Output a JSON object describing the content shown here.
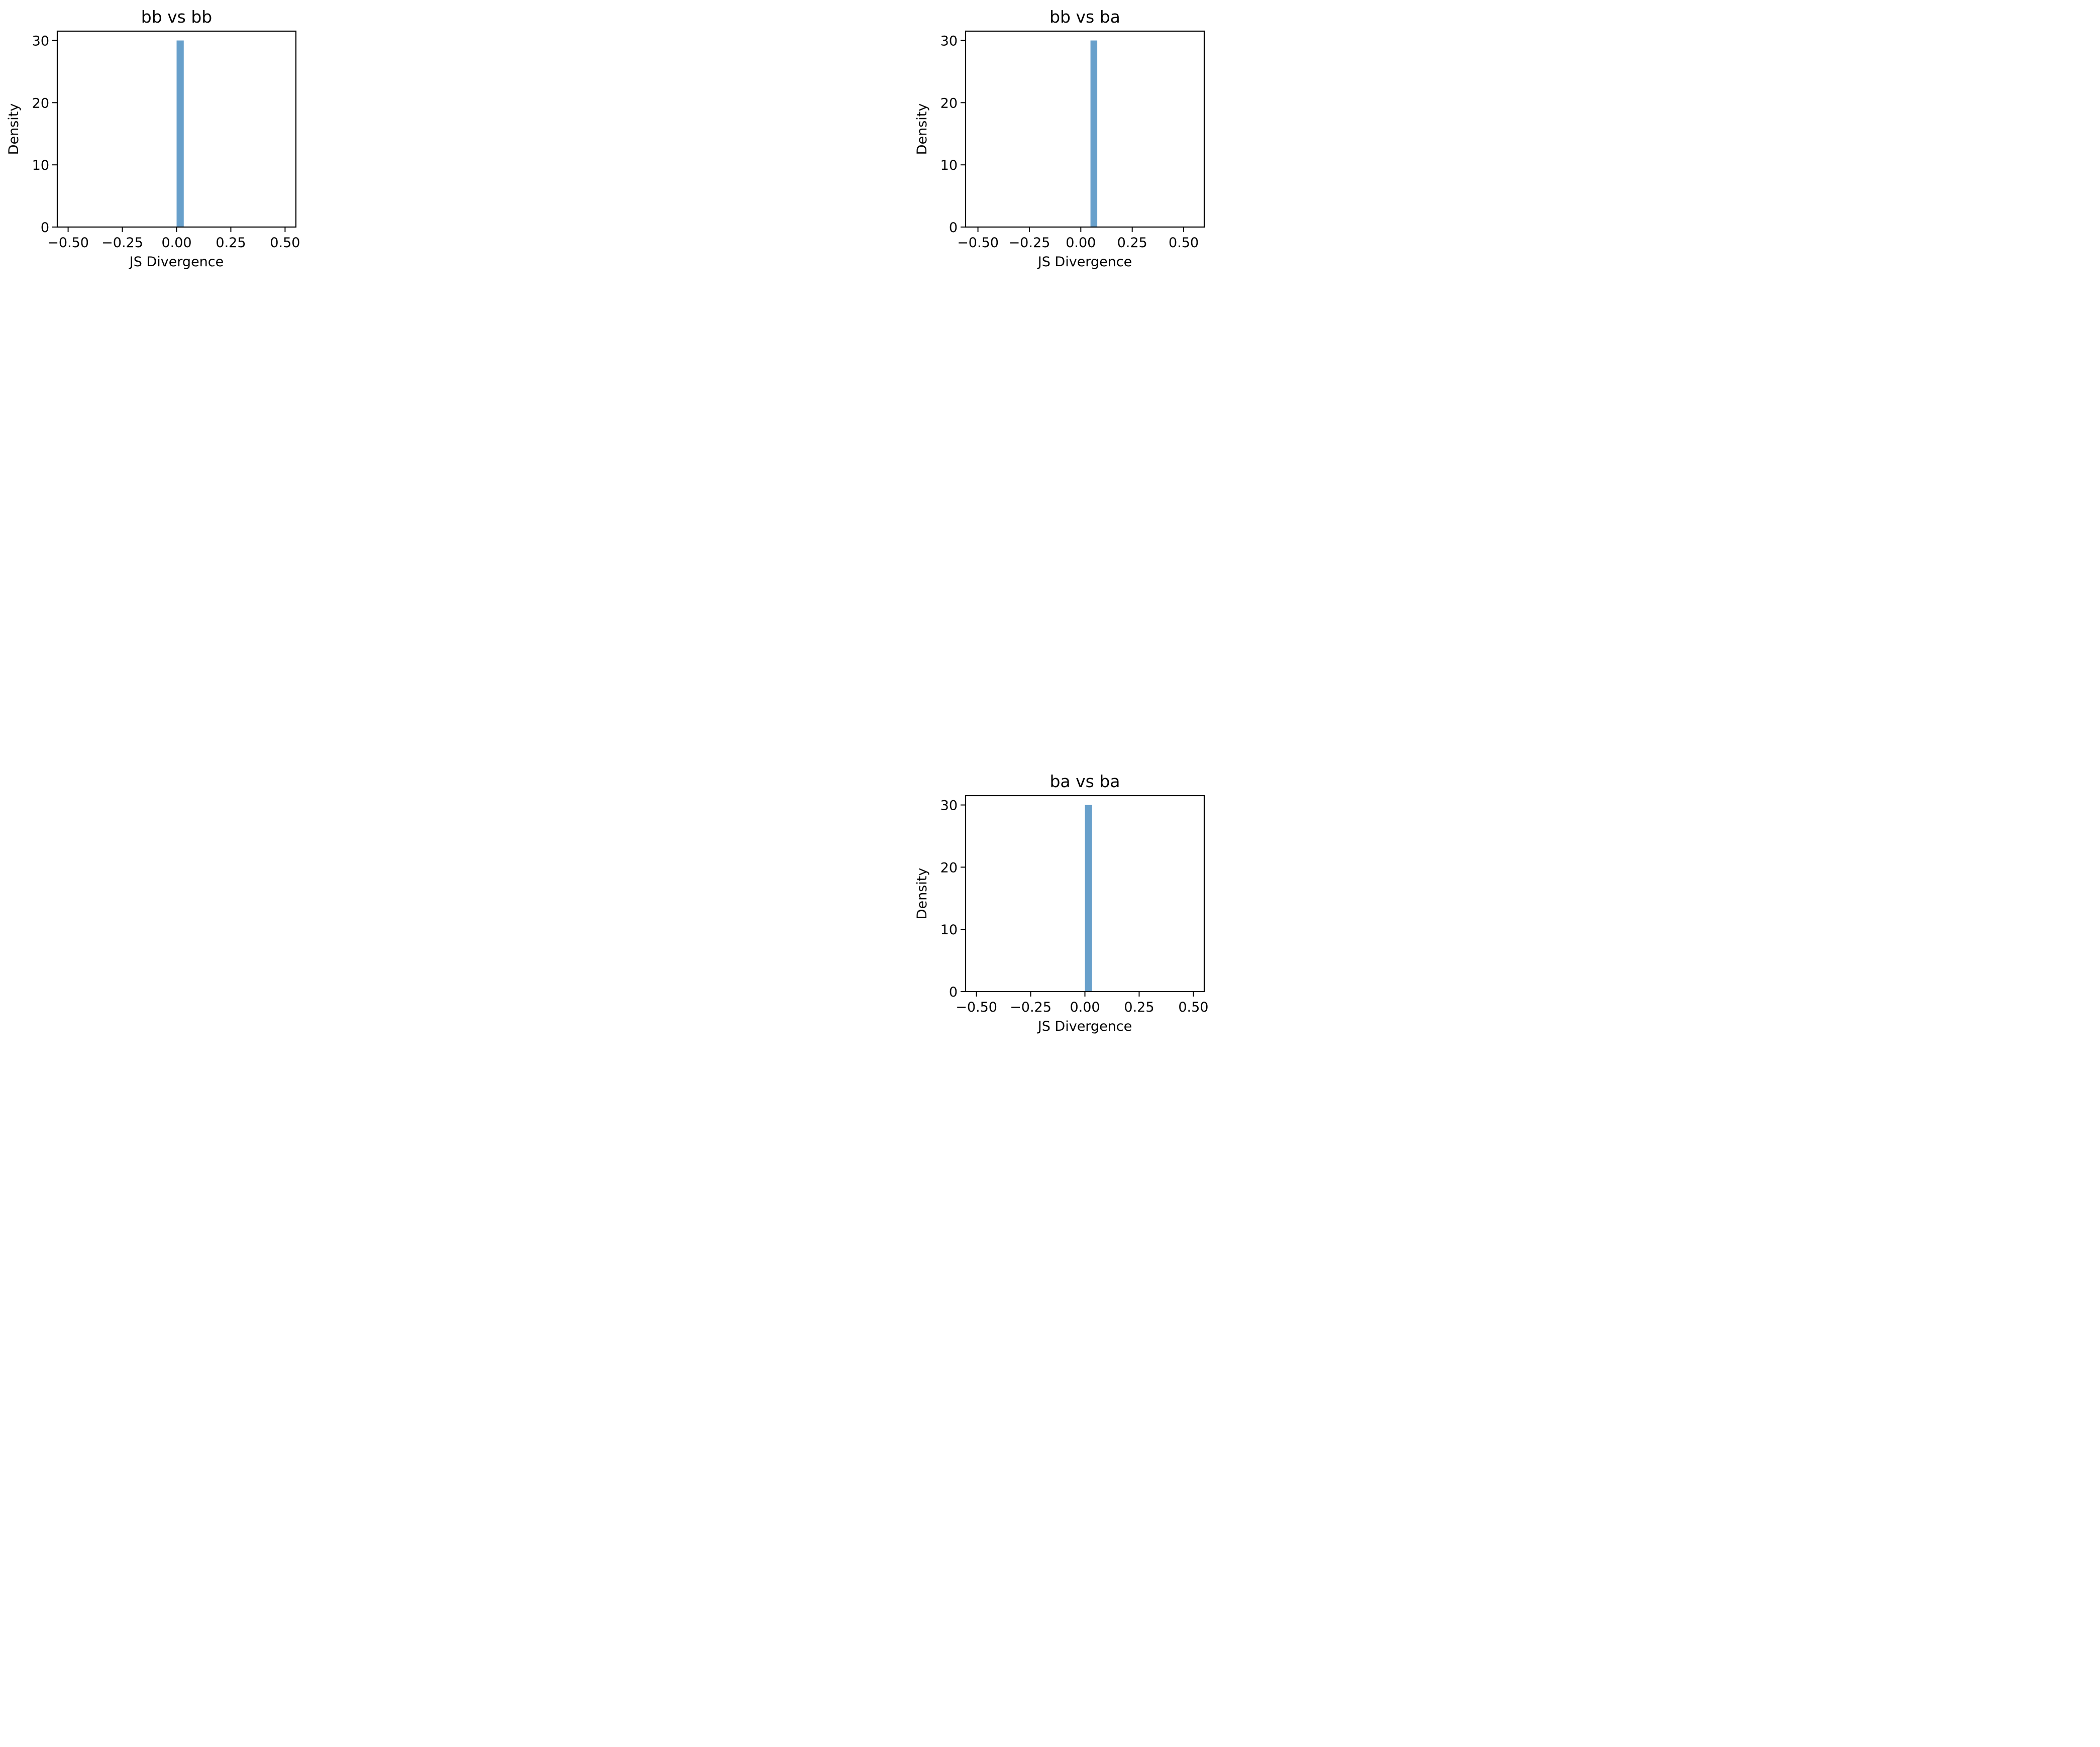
{
  "colors": {
    "bar": "#2878b5",
    "axis": "#000000",
    "background": "#ffffff"
  },
  "chart_data": [
    {
      "type": "bar",
      "title": "bb vs bb",
      "xlabel": "JS Divergence",
      "ylabel": "Density",
      "xlim": [
        -0.55,
        0.55
      ],
      "ylim": [
        0,
        31.5
      ],
      "xticks": [
        -0.5,
        -0.25,
        0.0,
        0.25,
        0.5
      ],
      "xtick_labels": [
        "−0.50",
        "−0.25",
        "0.00",
        "0.25",
        "0.50"
      ],
      "yticks": [
        0,
        10,
        20,
        30
      ],
      "ytick_labels": [
        "0",
        "10",
        "20",
        "30"
      ],
      "bars": [
        {
          "x0": 0.0,
          "x1": 0.033,
          "value": 30
        }
      ]
    },
    {
      "type": "bar",
      "title": "bb vs ba",
      "xlabel": "JS Divergence",
      "ylabel": "Density",
      "xlim": [
        -0.56,
        0.6
      ],
      "ylim": [
        0,
        31.5
      ],
      "xticks": [
        -0.5,
        -0.25,
        0.0,
        0.25,
        0.5
      ],
      "xtick_labels": [
        "−0.50",
        "−0.25",
        "0.00",
        "0.25",
        "0.50"
      ],
      "yticks": [
        0,
        10,
        20,
        30
      ],
      "ytick_labels": [
        "0",
        "10",
        "20",
        "30"
      ],
      "bars": [
        {
          "x0": 0.047,
          "x1": 0.08,
          "value": 30
        }
      ]
    },
    {
      "type": "bar",
      "title": "ba vs ba",
      "xlabel": "JS Divergence",
      "ylabel": "Density",
      "xlim": [
        -0.55,
        0.55
      ],
      "ylim": [
        0,
        31.5
      ],
      "xticks": [
        -0.5,
        -0.25,
        0.0,
        0.25,
        0.5
      ],
      "xtick_labels": [
        "−0.50",
        "−0.25",
        "0.00",
        "0.25",
        "0.50"
      ],
      "yticks": [
        0,
        10,
        20,
        30
      ],
      "ytick_labels": [
        "0",
        "10",
        "20",
        "30"
      ],
      "bars": [
        {
          "x0": 0.0,
          "x1": 0.033,
          "value": 30
        }
      ]
    }
  ]
}
